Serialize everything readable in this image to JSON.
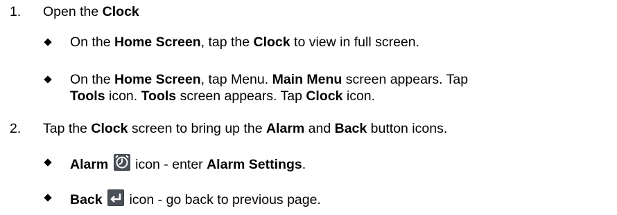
{
  "steps": [
    {
      "number": "1.",
      "text_1": "Open the ",
      "bold_1": "Clock",
      "bullets": [
        {
          "b1": "On the ",
          "b1_bold": "Home Screen",
          "b1_rest": ", tap the ",
          "b1_bold2": "Clock",
          "b1_end": " to view in full screen."
        },
        {
          "p1": "On the ",
          "p1_bold": "Home Screen",
          "p1_mid": ", tap Menu.  ",
          "p1_bold2": "Main Menu",
          "p1_end": " screen appears.  Tap",
          "p2_bold": "Tools",
          "p2_mid": " icon.  ",
          "p2_bold2": "Tools",
          "p2_mid2": " screen appears.  Tap ",
          "p2_bold3": "Clock",
          "p2_end": " icon."
        }
      ]
    },
    {
      "number": "2.",
      "t1": "Tap the ",
      "t1_bold": "Clock",
      "t2": " screen to bring up the ",
      "t2_bold": "Alarm",
      "t3": " and ",
      "t3_bold": "Back",
      "t4": " button icons.",
      "bullets": [
        {
          "bold": "Alarm",
          "icon": "alarm-icon",
          "mid": " icon - enter ",
          "bold2": "Alarm Settings",
          "end": "."
        },
        {
          "bold": "Back",
          "icon": "back-icon",
          "end": " icon - go back to previous page."
        }
      ]
    }
  ],
  "colors": {
    "icon_bg": "#3f434a",
    "icon_fg": "#ffffff"
  }
}
